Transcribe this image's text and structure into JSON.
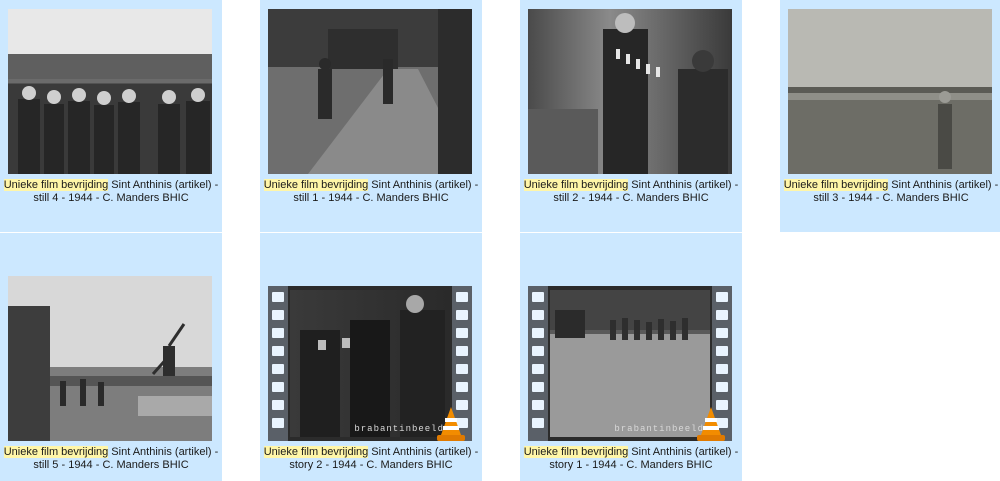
{
  "items": [
    {
      "name_hl": "Unieke film bevrijding",
      "name_rest": " Sint Anthinis (artikel) -",
      "line2": "still 4 - 1944 - C. Manders BHIC",
      "kind": "image"
    },
    {
      "name_hl": "Unieke film bevrijding",
      "name_rest": " Sint Anthinis (artikel) -",
      "line2": "still 1 - 1944 - C. Manders BHIC",
      "kind": "image"
    },
    {
      "name_hl": "Unieke film bevrijding",
      "name_rest": " Sint Anthinis (artikel) -",
      "line2": "still 2 - 1944 - C. Manders BHIC",
      "kind": "image"
    },
    {
      "name_hl": "Unieke film bevrijding",
      "name_rest": " Sint Anthinis (artikel) -",
      "line2": "still 3 - 1944 - C. Manders BHIC",
      "kind": "image"
    },
    {
      "name_hl": "Unieke film bevrijding",
      "name_rest": " Sint Anthinis (artikel) -",
      "line2": "still 5 - 1944 - C. Manders BHIC",
      "kind": "image"
    },
    {
      "name_hl": "Unieke film bevrijding",
      "name_rest": " Sint Anthinis (artikel) -",
      "line2": "story 2 - 1944 - C. Manders BHIC",
      "kind": "video",
      "watermark": "brabantinbeeld"
    },
    {
      "name_hl": "Unieke film bevrijding",
      "name_rest": " Sint Anthinis (artikel) -",
      "line2": "story 1 - 1944 - C. Manders BHIC",
      "kind": "video",
      "watermark": "brabantinbeeld"
    }
  ],
  "colors": {
    "selection": "#cce8ff",
    "highlight": "#fff6a8",
    "vlc_orange": "#f28c00"
  },
  "icons": {
    "video_overlay": "vlc-cone-icon"
  }
}
